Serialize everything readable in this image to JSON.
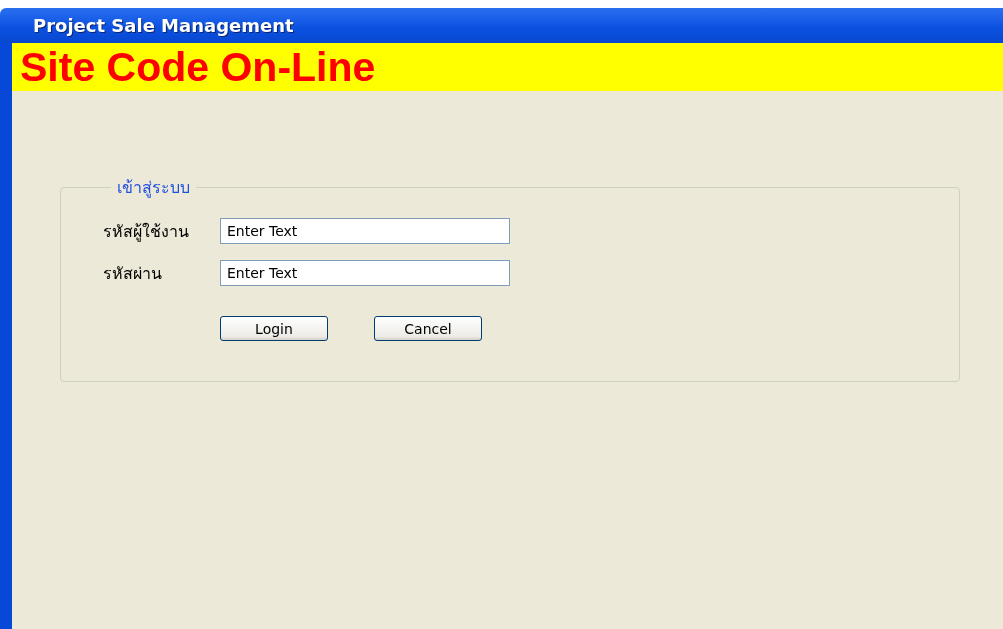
{
  "window": {
    "title": "Project Sale Management"
  },
  "banner": {
    "title": "Site Code On-Line"
  },
  "login_group": {
    "legend": "เข้าสู่ระบบ",
    "fields": [
      {
        "label": "รหัสผู้ใช้งาน",
        "value": "Enter Text"
      },
      {
        "label": "รหัสผ่าน",
        "value": "Enter Text"
      }
    ],
    "buttons": [
      "Login",
      "Cancel"
    ]
  }
}
